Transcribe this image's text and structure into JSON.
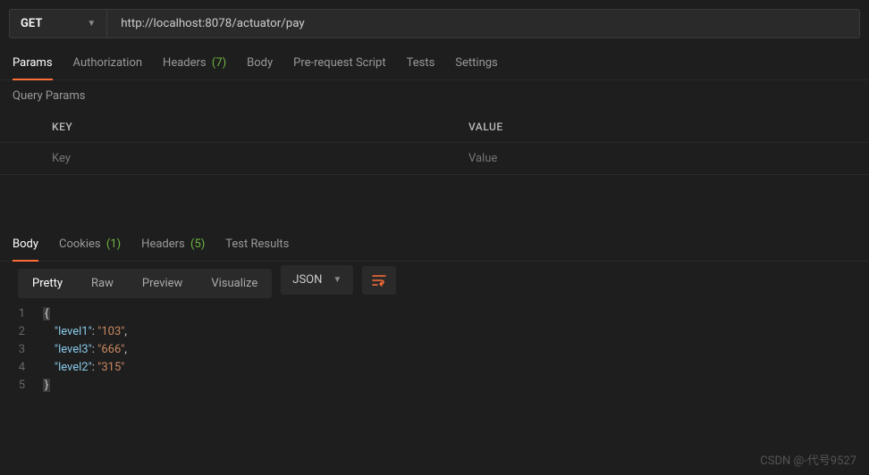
{
  "method": "GET",
  "url": "http://localhost:8078/actuator/pay",
  "reqTabs": [
    {
      "label": "Params",
      "active": true
    },
    {
      "label": "Authorization"
    },
    {
      "label": "Headers",
      "count": "(7)"
    },
    {
      "label": "Body"
    },
    {
      "label": "Pre-request Script"
    },
    {
      "label": "Tests"
    },
    {
      "label": "Settings"
    }
  ],
  "subHeader": "Query Params",
  "cols": {
    "key": "KEY",
    "value": "VALUE"
  },
  "ph": {
    "key": "Key",
    "value": "Value"
  },
  "respTabs": [
    {
      "label": "Body",
      "active": true
    },
    {
      "label": "Cookies",
      "count": "(1)"
    },
    {
      "label": "Headers",
      "count": "(5)"
    },
    {
      "label": "Test Results"
    }
  ],
  "viewTabs": [
    {
      "label": "Pretty",
      "active": true
    },
    {
      "label": "Raw"
    },
    {
      "label": "Preview"
    },
    {
      "label": "Visualize"
    }
  ],
  "fmt": "JSON",
  "json": [
    {
      "k": "level1",
      "v": "103",
      "c": true
    },
    {
      "k": "level3",
      "v": "666",
      "c": true
    },
    {
      "k": "level2",
      "v": "315",
      "c": false
    }
  ],
  "watermark": "CSDN @-代号9527"
}
